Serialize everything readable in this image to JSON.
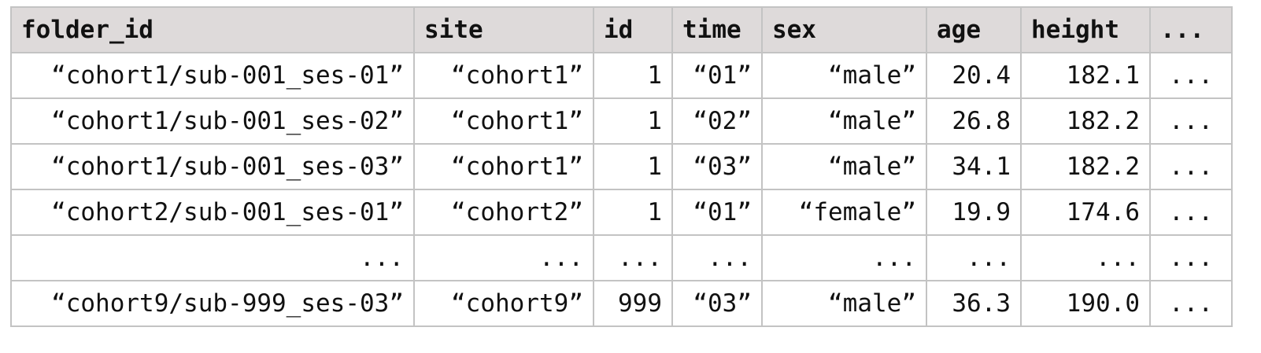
{
  "table": {
    "headers": [
      "folder_id",
      "site",
      "id",
      "time",
      "sex",
      "age",
      "height",
      "..."
    ],
    "rows": [
      [
        "“cohort1/sub-001_ses-01”",
        "“cohort1”",
        "1",
        "“01”",
        "“male”",
        "20.4",
        "182.1",
        "..."
      ],
      [
        "“cohort1/sub-001_ses-02”",
        "“cohort1”",
        "1",
        "“02”",
        "“male”",
        "26.8",
        "182.2",
        "..."
      ],
      [
        "“cohort1/sub-001_ses-03”",
        "“cohort1”",
        "1",
        "“03”",
        "“male”",
        "34.1",
        "182.2",
        "..."
      ],
      [
        "“cohort2/sub-001_ses-01”",
        "“cohort2”",
        "1",
        "“01”",
        "“female”",
        "19.9",
        "174.6",
        "..."
      ],
      [
        "...",
        "...",
        "...",
        "...",
        "...",
        "...",
        "...",
        "..."
      ],
      [
        "“cohort9/sub-999_ses-03”",
        "“cohort9”",
        "999",
        "“03”",
        "“male”",
        "36.3",
        "190.0",
        "..."
      ]
    ]
  },
  "colors": {
    "header_background": "#dedada",
    "grid_border": "#c3c3c3",
    "text": "#111111"
  }
}
